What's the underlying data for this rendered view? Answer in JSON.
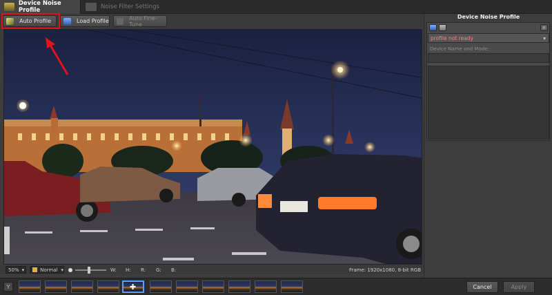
{
  "tabs": [
    {
      "label": "Device Noise Profile",
      "active": true
    },
    {
      "label": "Noise Filter Settings",
      "active": false
    }
  ],
  "toolbar": {
    "auto_profile": "Auto Profile",
    "load_profile": "Load Profile",
    "auto_fine_tune": "Auto Fine-Tune"
  },
  "statusbar": {
    "zoom": "50%",
    "mode": "Normal",
    "w_label": "W:",
    "h_label": "H:",
    "r_label": "R:",
    "g_label": "G:",
    "b_label": "B:",
    "frame_info": "Frame: 1920x1080, 8-bit RGB"
  },
  "right_panel": {
    "title": "Device Noise Profile",
    "profile_status": "profile not ready",
    "device_label": "Device Name and Mode:"
  },
  "filmstrip": {
    "thumb_count": 11,
    "selected_index": 4
  },
  "dialog": {
    "cancel": "Cancel",
    "apply": "Apply"
  },
  "colors": {
    "highlight": "#e0121b",
    "status_warning": "#ff7a88",
    "selected_thumb": "#5aa0ff"
  }
}
